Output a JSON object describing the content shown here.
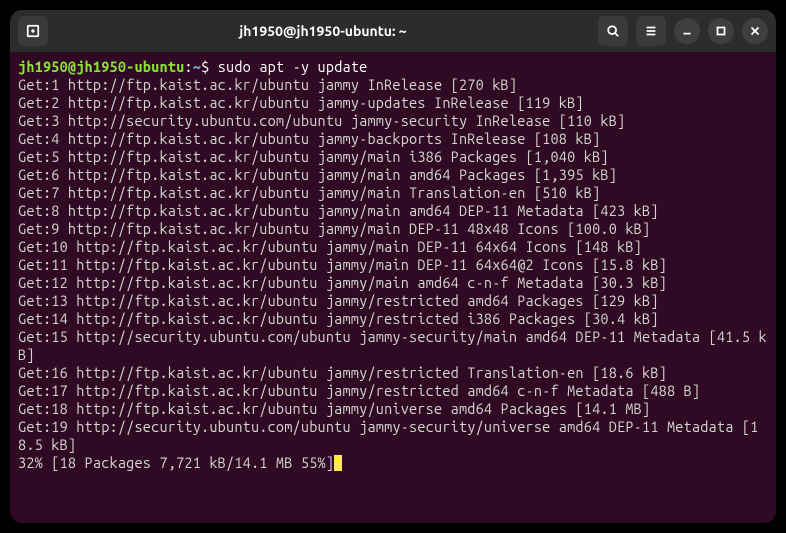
{
  "titlebar": {
    "title": "jh1950@jh1950-ubuntu: ~"
  },
  "prompt": {
    "user_host": "jh1950@jh1950-ubuntu",
    "sep": ":",
    "path": "~",
    "dollar": "$",
    "command": "sudo apt -y update"
  },
  "lines": [
    "Get:1 http://ftp.kaist.ac.kr/ubuntu jammy InRelease [270 kB]",
    "Get:2 http://ftp.kaist.ac.kr/ubuntu jammy-updates InRelease [119 kB]",
    "Get:3 http://security.ubuntu.com/ubuntu jammy-security InRelease [110 kB]",
    "Get:4 http://ftp.kaist.ac.kr/ubuntu jammy-backports InRelease [108 kB]",
    "Get:5 http://ftp.kaist.ac.kr/ubuntu jammy/main i386 Packages [1,040 kB]",
    "Get:6 http://ftp.kaist.ac.kr/ubuntu jammy/main amd64 Packages [1,395 kB]",
    "Get:7 http://ftp.kaist.ac.kr/ubuntu jammy/main Translation-en [510 kB]",
    "Get:8 http://ftp.kaist.ac.kr/ubuntu jammy/main amd64 DEP-11 Metadata [423 kB]",
    "Get:9 http://ftp.kaist.ac.kr/ubuntu jammy/main DEP-11 48x48 Icons [100.0 kB]",
    "Get:10 http://ftp.kaist.ac.kr/ubuntu jammy/main DEP-11 64x64 Icons [148 kB]",
    "Get:11 http://ftp.kaist.ac.kr/ubuntu jammy/main DEP-11 64x64@2 Icons [15.8 kB]",
    "Get:12 http://ftp.kaist.ac.kr/ubuntu jammy/main amd64 c-n-f Metadata [30.3 kB]",
    "Get:13 http://ftp.kaist.ac.kr/ubuntu jammy/restricted amd64 Packages [129 kB]",
    "Get:14 http://ftp.kaist.ac.kr/ubuntu jammy/restricted i386 Packages [30.4 kB]",
    "Get:15 http://security.ubuntu.com/ubuntu jammy-security/main amd64 DEP-11 Metadata [41.5 kB]",
    "Get:16 http://ftp.kaist.ac.kr/ubuntu jammy/restricted Translation-en [18.6 kB]",
    "Get:17 http://ftp.kaist.ac.kr/ubuntu jammy/restricted amd64 c-n-f Metadata [488 B]",
    "Get:18 http://ftp.kaist.ac.kr/ubuntu jammy/universe amd64 Packages [14.1 MB]",
    "Get:19 http://security.ubuntu.com/ubuntu jammy-security/universe amd64 DEP-11 Metadata [18.5 kB]"
  ],
  "progress": {
    "text": "32% [18 Packages 7,721 kB/14.1 MB 55%]"
  }
}
